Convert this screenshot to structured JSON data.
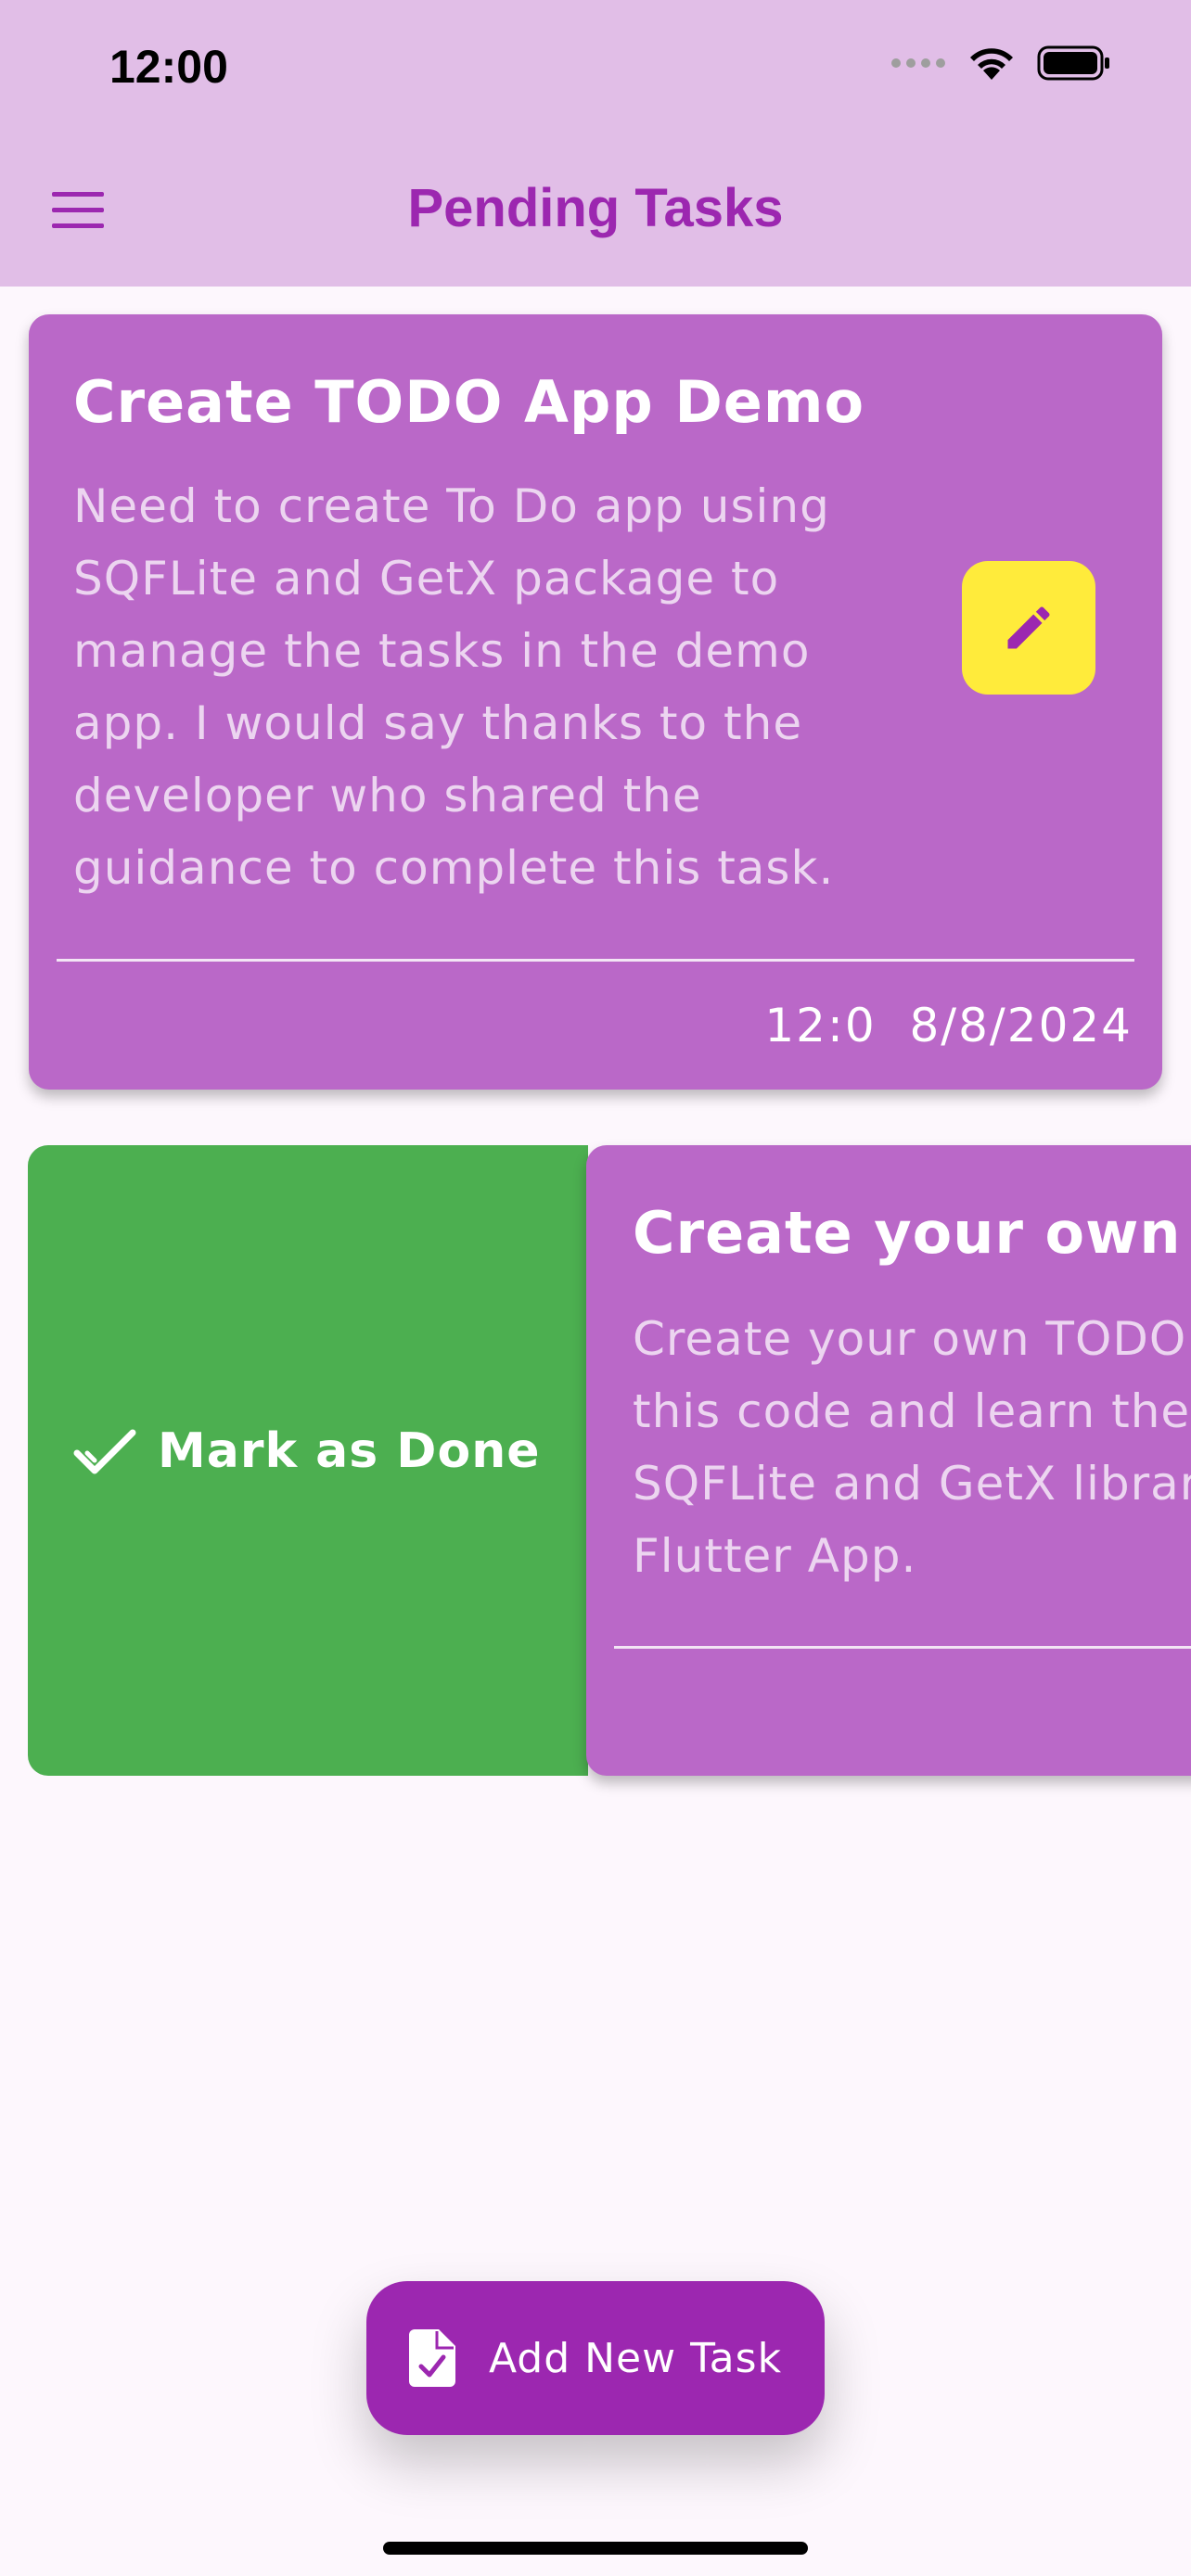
{
  "status_bar": {
    "time": "12:00"
  },
  "app_bar": {
    "title": "Pending Tasks",
    "menu_icon": "hamburger-menu-icon"
  },
  "tasks": [
    {
      "title": "Create TODO App Demo",
      "description": "Need to create To Do app using SQFLite and GetX package to manage the tasks in the demo app. I would say thanks to the developer who shared the guidance to complete this task.",
      "time": "12:0",
      "date": "8/8/2024",
      "edit_icon": "pencil-icon"
    },
    {
      "title": "Create your own T",
      "description": "Create your own TODO this code and learn the SQFLite and GetX librar Flutter App."
    }
  ],
  "swipe_action": {
    "label": "Mark as Done",
    "icon": "checkmark-icon",
    "color": "#4caf50"
  },
  "fab": {
    "label": "Add New Task",
    "icon": "task-document-icon"
  },
  "colors": {
    "app_bar": "#e1bee7",
    "primary": "#9c27b0",
    "card": "#ba68c8",
    "edit_button": "#ffeb3b",
    "background": "#fdf7fd"
  }
}
